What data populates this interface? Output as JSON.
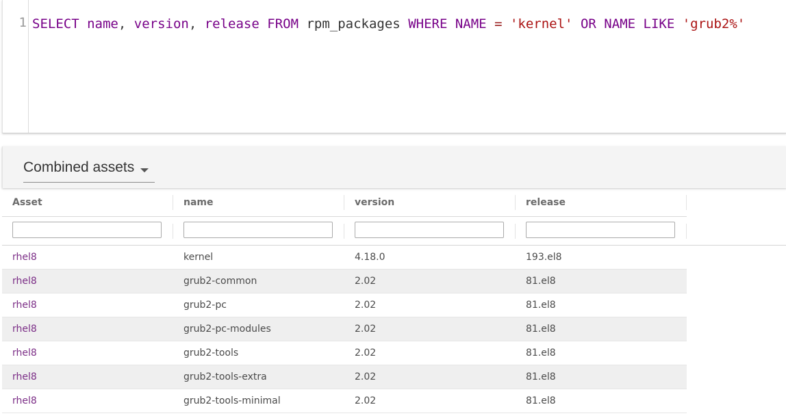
{
  "editor": {
    "line_number": "1",
    "query_tokens": [
      {
        "text": "SELECT",
        "type": "kw"
      },
      {
        "text": " ",
        "type": "plain"
      },
      {
        "text": "name",
        "type": "kw"
      },
      {
        "text": ", ",
        "type": "plain"
      },
      {
        "text": "version",
        "type": "kw"
      },
      {
        "text": ", ",
        "type": "plain"
      },
      {
        "text": "release",
        "type": "kw"
      },
      {
        "text": " ",
        "type": "plain"
      },
      {
        "text": "FROM",
        "type": "kw"
      },
      {
        "text": " ",
        "type": "plain"
      },
      {
        "text": "rpm_packages",
        "type": "var"
      },
      {
        "text": " ",
        "type": "plain"
      },
      {
        "text": "WHERE",
        "type": "kw"
      },
      {
        "text": " ",
        "type": "plain"
      },
      {
        "text": "NAME",
        "type": "kw"
      },
      {
        "text": " ",
        "type": "plain"
      },
      {
        "text": "=",
        "type": "op"
      },
      {
        "text": " ",
        "type": "plain"
      },
      {
        "text": "'kernel'",
        "type": "str"
      },
      {
        "text": " ",
        "type": "plain"
      },
      {
        "text": "OR",
        "type": "kw"
      },
      {
        "text": " ",
        "type": "plain"
      },
      {
        "text": "NAME",
        "type": "kw"
      },
      {
        "text": " ",
        "type": "plain"
      },
      {
        "text": "LIKE",
        "type": "kw"
      },
      {
        "text": " ",
        "type": "plain"
      },
      {
        "text": "'grub2%'",
        "type": "str"
      }
    ]
  },
  "results": {
    "source_selector": {
      "label": "Combined assets",
      "icon": "caret-down-icon"
    },
    "columns": [
      "Asset",
      "name",
      "version",
      "release"
    ],
    "filters": [
      "",
      "",
      "",
      ""
    ],
    "rows": [
      [
        "rhel8",
        "kernel",
        "4.18.0",
        "193.el8"
      ],
      [
        "rhel8",
        "grub2-common",
        "2.02",
        "81.el8"
      ],
      [
        "rhel8",
        "grub2-pc",
        "2.02",
        "81.el8"
      ],
      [
        "rhel8",
        "grub2-pc-modules",
        "2.02",
        "81.el8"
      ],
      [
        "rhel8",
        "grub2-tools",
        "2.02",
        "81.el8"
      ],
      [
        "rhel8",
        "grub2-tools-extra",
        "2.02",
        "81.el8"
      ],
      [
        "rhel8",
        "grub2-tools-minimal",
        "2.02",
        "81.el8"
      ]
    ]
  },
  "colors": {
    "keyword": "#770088",
    "string": "#aa1111",
    "operator": "#981a1a",
    "asset_link": "#7b2d86",
    "alt_row": "#efefef"
  }
}
